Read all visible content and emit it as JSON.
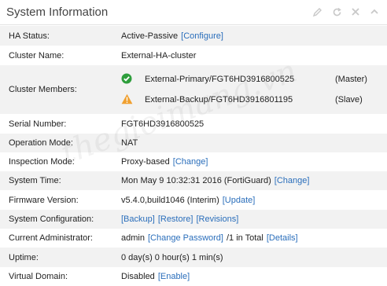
{
  "header": {
    "title": "System Information"
  },
  "rows": {
    "ha_status": {
      "label": "HA Status:",
      "value": "Active-Passive",
      "link": "[Configure]"
    },
    "cluster_name": {
      "label": "Cluster Name:",
      "value": "External-HA-cluster"
    },
    "cluster_members": {
      "label": "Cluster Members:",
      "members": [
        {
          "name": "External-Primary/FGT6HD3916800525",
          "role": "(Master)",
          "status_icon": "check-circle-icon",
          "status_color": "#2e9e3c"
        },
        {
          "name": "External-Backup/FGT6HD3916801195",
          "role": "(Slave)",
          "status_icon": "warning-icon",
          "status_color": "#f0a030"
        }
      ]
    },
    "serial_number": {
      "label": "Serial Number:",
      "value": "FGT6HD3916800525"
    },
    "operation_mode": {
      "label": "Operation Mode:",
      "value": "NAT"
    },
    "inspection_mode": {
      "label": "Inspection Mode:",
      "value": "Proxy-based",
      "link": "[Change]"
    },
    "system_time": {
      "label": "System Time:",
      "value": "Mon May 9 10:32:31 2016 (FortiGuard)",
      "link": "[Change]"
    },
    "firmware_version": {
      "label": "Firmware Version:",
      "value": "v5.4.0,build1046 (Interim)",
      "link": "[Update]"
    },
    "system_configuration": {
      "label": "System Configuration:",
      "link_backup": "[Backup]",
      "link_restore": "[Restore]",
      "link_revisions": "[Revisions]"
    },
    "current_administrator": {
      "label": "Current Administrator:",
      "value_prefix": "admin",
      "link_change_password": "[Change Password]",
      "value_mid": "/1 in Total",
      "link_details": "[Details]"
    },
    "uptime": {
      "label": "Uptime:",
      "value": "0 day(s) 0 hour(s) 1 min(s)"
    },
    "virtual_domain": {
      "label": "Virtual Domain:",
      "value": "Disabled",
      "link": "[Enable]"
    }
  },
  "watermark": "thegioimang.vn",
  "colors": {
    "link": "#2a6ebb",
    "row_alt": "#f2f2f2",
    "header_icon": "#c8c8c8"
  }
}
